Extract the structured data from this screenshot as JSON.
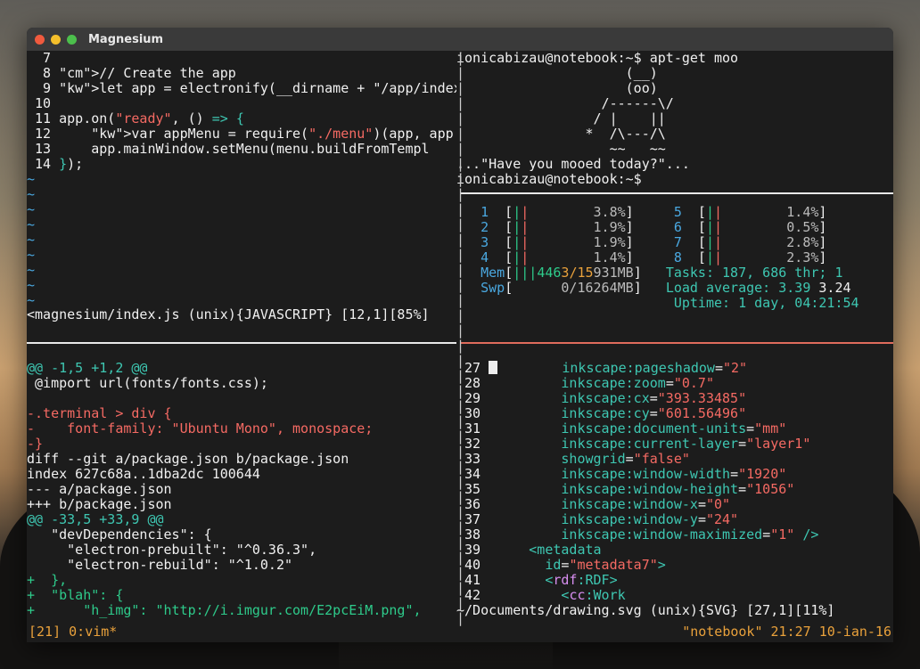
{
  "window": {
    "title": "Magnesium"
  },
  "vim_top": {
    "lines": [
      {
        "n": "  7",
        "t": ""
      },
      {
        "n": "  8",
        "t": " // Create the app"
      },
      {
        "n": "  9",
        "t": " let app = electronify(__dirname + \"/app/index."
      },
      {
        "n": " 10",
        "t": ""
      },
      {
        "n": " 11",
        "t": " app.on(\"ready\", () => {"
      },
      {
        "n": " 12",
        "t": "     var appMenu = require(\"./menu\")(app, app.m"
      },
      {
        "n": " 13",
        "t": "     app.mainWindow.setMenu(menu.buildFromTempl"
      },
      {
        "n": " 14",
        "t": " });"
      }
    ],
    "tilde": "~",
    "status": "<magnesium/index.js (unix){JAVASCRIPT} [12,1][85%]"
  },
  "shell": {
    "l1": "ionicabizau@notebook:~$ apt-get moo",
    "cow": [
      " (__)",
      " (oo)",
      " /------\\/",
      " / |    ||",
      " *  /\\---/\\",
      " ~~   ~~"
    ],
    "l8": "...\"Have you mooed today?\"...",
    "l9": "ionicabizau@notebook:~$"
  },
  "htop": {
    "cpus_left": [
      {
        "n": "1",
        "pct": "3.8%"
      },
      {
        "n": "2",
        "pct": "1.9%"
      },
      {
        "n": "3",
        "pct": "1.9%"
      },
      {
        "n": "4",
        "pct": "1.4%"
      }
    ],
    "cpus_right": [
      {
        "n": "5",
        "pct": "1.4%"
      },
      {
        "n": "6",
        "pct": "0.5%"
      },
      {
        "n": "7",
        "pct": "2.8%"
      },
      {
        "n": "8",
        "pct": "2.3%"
      }
    ],
    "mem_label": "Mem",
    "mem_used": "446",
    "mem_b": "3",
    "mem_c": "/15",
    "mem_total": "931MB",
    "swp_label": "Swp",
    "swp_value": "0/16264MB",
    "tasks": "Tasks: 187, 686 thr; 1",
    "load": "Load average: 3.39 ",
    "load2": "3.24",
    "uptime": "Uptime: 1 day, 04:21:54"
  },
  "diff": {
    "lines": [
      {
        "c": "cy",
        "t": "@@ -1,5 +1,2 @@"
      },
      {
        "c": "wh",
        "t": " @import url(fonts/fonts.css);"
      },
      {
        "c": "wh",
        "t": ""
      },
      {
        "c": "rd",
        "t": "-.terminal > div {"
      },
      {
        "c": "rd",
        "t": "-    font-family: \"Ubuntu Mono\", monospace;"
      },
      {
        "c": "rd",
        "t": "-}"
      },
      {
        "c": "wh",
        "t": "diff --git a/package.json b/package.json"
      },
      {
        "c": "wh",
        "t": "index 627c68a..1dba2dc 100644"
      },
      {
        "c": "wh",
        "t": "--- a/package.json"
      },
      {
        "c": "wh",
        "t": "+++ b/package.json"
      },
      {
        "c": "cy",
        "t": "@@ -33,5 +33,9 @@"
      },
      {
        "c": "wh",
        "t": "   \"devDependencies\": {"
      },
      {
        "c": "wh",
        "t": "     \"electron-prebuilt\": \"^0.36.3\","
      },
      {
        "c": "wh",
        "t": "     \"electron-rebuild\": \"^1.0.2\""
      },
      {
        "c": "gn",
        "t": "+  },"
      },
      {
        "c": "gn",
        "t": "+  \"blah\": {"
      },
      {
        "c": "gn",
        "t": "+      \"h_img\": \"http://i.imgur.com/E2pcEiM.png\","
      },
      {
        "c": "wh",
        "t": ":"
      }
    ]
  },
  "svg": {
    "lines": [
      {
        "n": " 27",
        "a": "inkscape:pageshadow",
        "v": "\"2\"",
        "k": "attr",
        "cur": true
      },
      {
        "n": " 28",
        "a": "inkscape:zoom",
        "v": "\"0.7\"",
        "k": "attr"
      },
      {
        "n": " 29",
        "a": "inkscape:cx",
        "v": "\"393.33485\"",
        "k": "attr"
      },
      {
        "n": " 30",
        "a": "inkscape:cy",
        "v": "\"601.56496\"",
        "k": "attr"
      },
      {
        "n": " 31",
        "a": "inkscape:document-units",
        "v": "\"mm\"",
        "k": "attr"
      },
      {
        "n": " 32",
        "a": "inkscape:current-layer",
        "v": "\"layer1\"",
        "k": "attr"
      },
      {
        "n": " 33",
        "a": "showgrid",
        "v": "\"false\"",
        "k": "attr"
      },
      {
        "n": " 34",
        "a": "inkscape:window-width",
        "v": "\"1920\"",
        "k": "attr"
      },
      {
        "n": " 35",
        "a": "inkscape:window-height",
        "v": "\"1056\"",
        "k": "attr"
      },
      {
        "n": " 36",
        "a": "inkscape:window-x",
        "v": "\"0\"",
        "k": "attr"
      },
      {
        "n": " 37",
        "a": "inkscape:window-y",
        "v": "\"24\"",
        "k": "attr"
      },
      {
        "n": " 38",
        "a": "inkscape:window-maximized",
        "v": "\"1\"",
        "k": "attr",
        "end": " />"
      },
      {
        "n": " 39",
        "a": "<metadata",
        "v": "",
        "k": "tag1"
      },
      {
        "n": " 40",
        "a": "id",
        "v": "\"metadata7\"",
        "k": "attr2",
        "end": ">"
      },
      {
        "n": " 41",
        "a": "<rdf:RDF",
        "v": "",
        "k": "tag2",
        "end": ">"
      },
      {
        "n": " 42",
        "a": "<cc:Work",
        "v": "",
        "k": "tag3"
      }
    ],
    "status": "~/Documents/drawing.svg (unix){SVG} [27,1][11%]"
  },
  "tmux": {
    "left": "[21] 0:vim*",
    "right": "\"notebook\" 21:27 10-ian-16"
  }
}
